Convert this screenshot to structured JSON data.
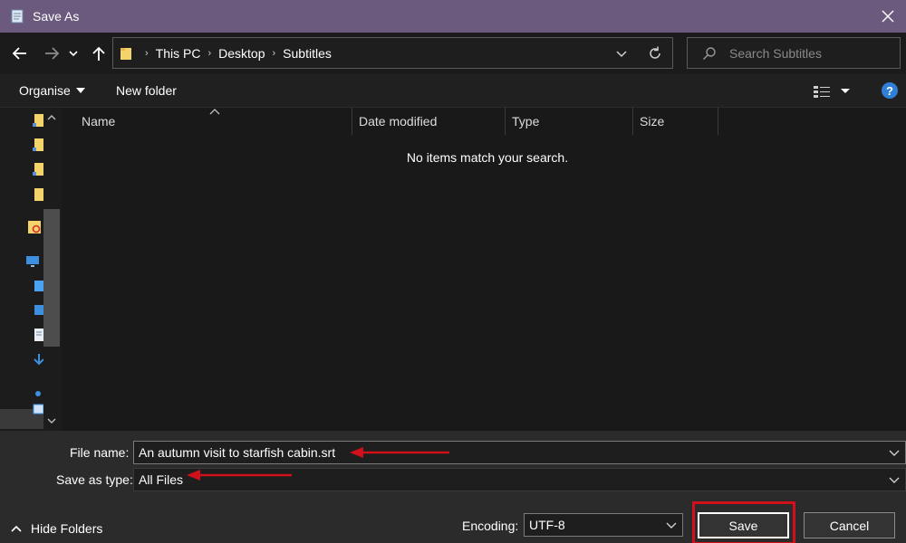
{
  "window": {
    "title": "Save As"
  },
  "address": {
    "crumbs": [
      "This PC",
      "Desktop",
      "Subtitles"
    ]
  },
  "search": {
    "placeholder": "Search Subtitles"
  },
  "toolbar": {
    "organise_label": "Organise",
    "new_folder_label": "New folder",
    "help_label": "?"
  },
  "filelist": {
    "columns": [
      "Name",
      "Date modified",
      "Type",
      "Size"
    ],
    "empty_message": "No items match your search."
  },
  "form": {
    "file_name_label": "File name:",
    "file_name_value": "An autumn visit to starfish cabin.srt",
    "save_type_label": "Save as type:",
    "save_type_value": "All Files",
    "encoding_label": "Encoding:",
    "encoding_value": "UTF-8"
  },
  "footer": {
    "hide_folders_label": "Hide Folders",
    "save_label": "Save",
    "cancel_label": "Cancel"
  },
  "colors": {
    "titlebar": "#6b5a7e",
    "annotation_red": "#d0101a",
    "help_blue": "#2f7fd8"
  }
}
